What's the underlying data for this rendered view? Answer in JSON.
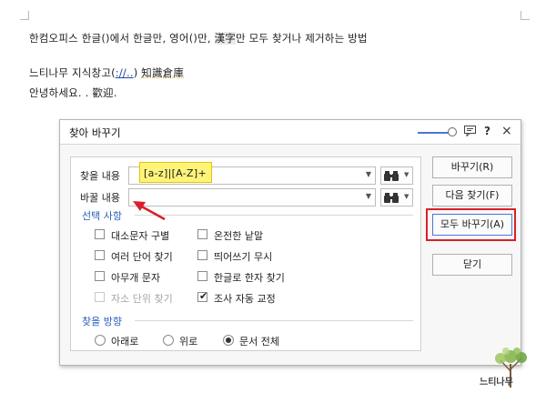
{
  "document": {
    "line1_before": "한컴오피스 한글()에서 한글만, 영어()만, ",
    "line1_hanja": "漢字",
    "line1_after": "만 모두 찾거나 제거하는 방법",
    "line2_prefix": "느티나무 지식창고(",
    "line2_link": "://..",
    "line2_close": ")",
    "line2_hanja": "知識倉庫",
    "line3_text": "안녕하세요. . ",
    "line3_hanja": "歡迎."
  },
  "dialog": {
    "title": "찾아 바꾸기",
    "help_glyph": "?",
    "close_glyph": "×",
    "find_label": "찾을 내용",
    "find_value": "[a-z]|[A-Z]+",
    "replace_label": "바꿀 내용",
    "replace_value": "",
    "dropdown_glyph": "▼",
    "options_title": "선택 사항",
    "options": [
      {
        "label": "대소문자 구별",
        "checked": false,
        "enabled": true
      },
      {
        "label": "온전한 낱말",
        "checked": false,
        "enabled": true
      },
      {
        "label": "여러 단어 찾기",
        "checked": false,
        "enabled": true
      },
      {
        "label": "띄어쓰기 무시",
        "checked": false,
        "enabled": true
      },
      {
        "label": "아무개 문자",
        "checked": false,
        "enabled": true
      },
      {
        "label": "한글로 한자 찾기",
        "checked": false,
        "enabled": true
      },
      {
        "label": "자소 단위 찾기",
        "checked": false,
        "enabled": false
      },
      {
        "label": "조사 자동 교정",
        "checked": true,
        "enabled": true
      }
    ],
    "check_glyph": "✔",
    "direction_title": "찾을 방향",
    "directions": [
      {
        "label": "아래로",
        "selected": false
      },
      {
        "label": "위로",
        "selected": false
      },
      {
        "label": "문서 전체",
        "selected": true
      }
    ],
    "buttons": {
      "replace": "바꾸기(R)",
      "find_next": "다음 찾기(F)",
      "replace_all": "모두 바꾸기(A)",
      "close": "닫기"
    }
  },
  "colors": {
    "highlight": "#fff47a",
    "annotation": "#d9202a",
    "accent": "#4a78d2"
  },
  "icons": {
    "binoculars": "binoculars-icon",
    "chat": "chat-icon",
    "help": "help-icon",
    "close": "close-icon"
  },
  "watermark": {
    "text": "느티나무"
  }
}
